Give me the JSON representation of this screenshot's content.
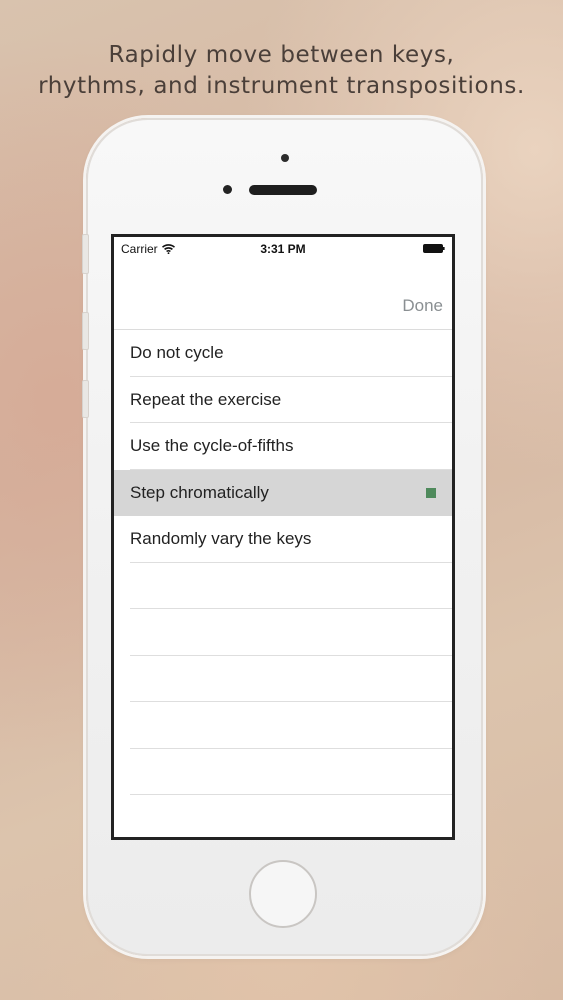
{
  "headline": {
    "line1": "Rapidly move between keys,",
    "line2": "rhythms, and instrument transpositions."
  },
  "status_bar": {
    "carrier": "Carrier",
    "time": "3:31 PM",
    "wifi_icon": "wifi-icon",
    "battery_icon": "battery-icon"
  },
  "nav_bar": {
    "done_label": "Done"
  },
  "options": [
    {
      "label": "Do not cycle",
      "selected": false
    },
    {
      "label": "Repeat the exercise",
      "selected": false
    },
    {
      "label": "Use the cycle-of-fifths",
      "selected": false
    },
    {
      "label": "Step chromatically",
      "selected": true
    },
    {
      "label": "Randomly vary the keys",
      "selected": false
    }
  ],
  "colors": {
    "selected_row": "#d6d6d6",
    "check_mark": "#4f8a5c",
    "done_text": "#8a8f92"
  }
}
